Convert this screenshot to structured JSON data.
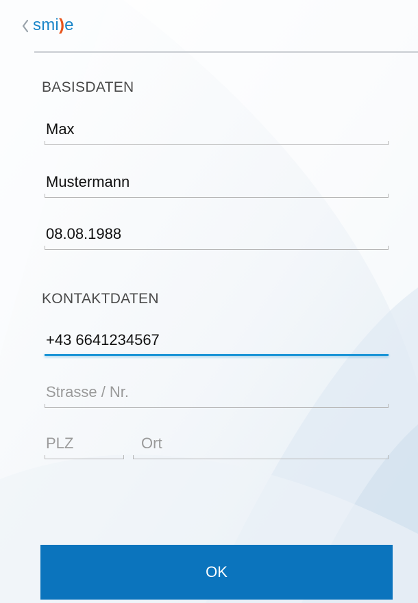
{
  "app": {
    "logo_text_left": "smi",
    "logo_text_paren": ")",
    "logo_text_right": "e",
    "back_icon": "chevron-left-icon"
  },
  "basisdaten": {
    "title": "BASISDATEN",
    "first_name": "Max",
    "last_name": "Mustermann",
    "birth_date": "08.08.1988"
  },
  "kontaktdaten": {
    "title": "KONTAKTDATEN",
    "phone": "+43 6641234567",
    "street_placeholder": "Strasse / Nr.",
    "zip_placeholder": "PLZ",
    "city_placeholder": "Ort"
  },
  "footer": {
    "ok_label": "OK"
  },
  "colors": {
    "brand_blue": "#1a85c8",
    "brand_orange": "#e8541c",
    "button_blue": "#0b74bd",
    "focus_blue": "#1a94d6"
  }
}
